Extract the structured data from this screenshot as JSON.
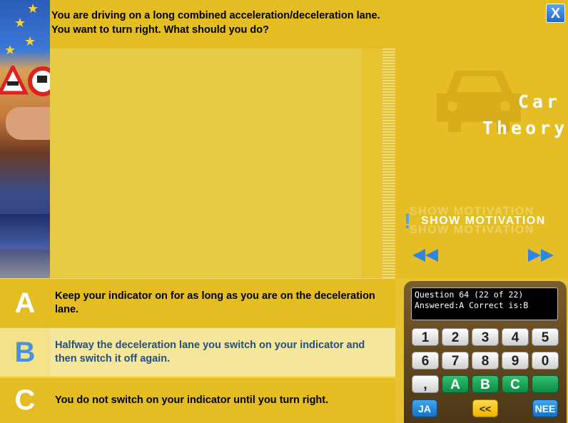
{
  "question": {
    "line1": "You are driving on a long combined acceleration/deceleration lane.",
    "line2": "You want to turn right. What should you do?"
  },
  "close_label": "X",
  "brand": {
    "line1": "Car",
    "line2": "Theory"
  },
  "motivation_label": "SHOW MOTIVATION",
  "nav": {
    "prev_icon": "double-left-arrow-icon",
    "next_icon": "double-right-arrow-icon"
  },
  "answers": [
    {
      "letter": "A",
      "text": "Keep your indicator on for as long as you are on the deceleration lane."
    },
    {
      "letter": "B",
      "text": "Halfway the deceleration lane you switch on your indicator and then switch it off again."
    },
    {
      "letter": "C",
      "text": "You do not switch on your indicator until you turn right."
    }
  ],
  "status": {
    "line1": "Question 64 (22 of 22)",
    "line2": "Answered:A Correct is:B"
  },
  "keypad": {
    "row1": [
      "1",
      "2",
      "3",
      "4",
      "5"
    ],
    "row2": [
      "6",
      "7",
      "8",
      "9",
      "0"
    ],
    "row3": [
      ",",
      "A",
      "B",
      "C",
      ""
    ],
    "ja": "JA",
    "back": "<<",
    "nee": "NEE"
  },
  "colors": {
    "panel": "#e3bd22",
    "selected": "#f4e69a",
    "accent_blue": "#4a90e0"
  }
}
